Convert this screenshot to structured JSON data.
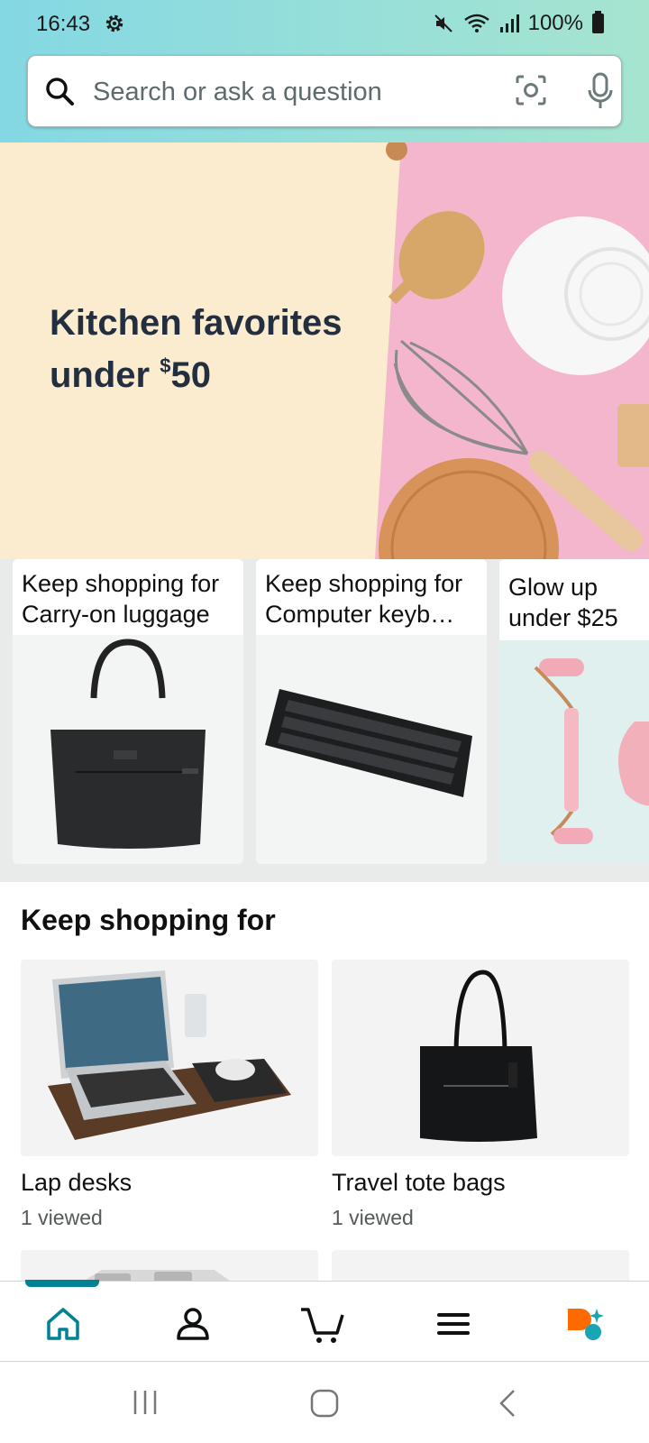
{
  "status_bar": {
    "time": "16:43",
    "battery": "100%"
  },
  "search": {
    "placeholder": "Search or ask a question"
  },
  "hero": {
    "title_line1": "Kitchen favorites",
    "title_prefix": "under ",
    "title_currency": "$",
    "title_amount": "50",
    "colors": {
      "cream": "#fbebcf",
      "pink": "#f4b6cc"
    }
  },
  "cards": [
    {
      "line1": "Keep shopping for",
      "line2": "Carry-on luggage"
    },
    {
      "line1": "Keep shopping for",
      "line2": "Computer keyb…"
    },
    {
      "line1": "Glow up",
      "line2": "under $25"
    }
  ],
  "keep_shopping": {
    "title": "Keep shopping for",
    "items": [
      {
        "name": "Lap desks",
        "sub": "1 viewed"
      },
      {
        "name": "Travel tote bags",
        "sub": "1 viewed"
      }
    ]
  },
  "bottom_nav": {
    "items": [
      "home-icon",
      "account-icon",
      "cart-icon",
      "menu-icon",
      "rufus-icon"
    ],
    "accent": "#008296",
    "rufus_color": "#ff6a00"
  },
  "system_nav": [
    "recents-icon",
    "home-button-icon",
    "back-icon"
  ]
}
